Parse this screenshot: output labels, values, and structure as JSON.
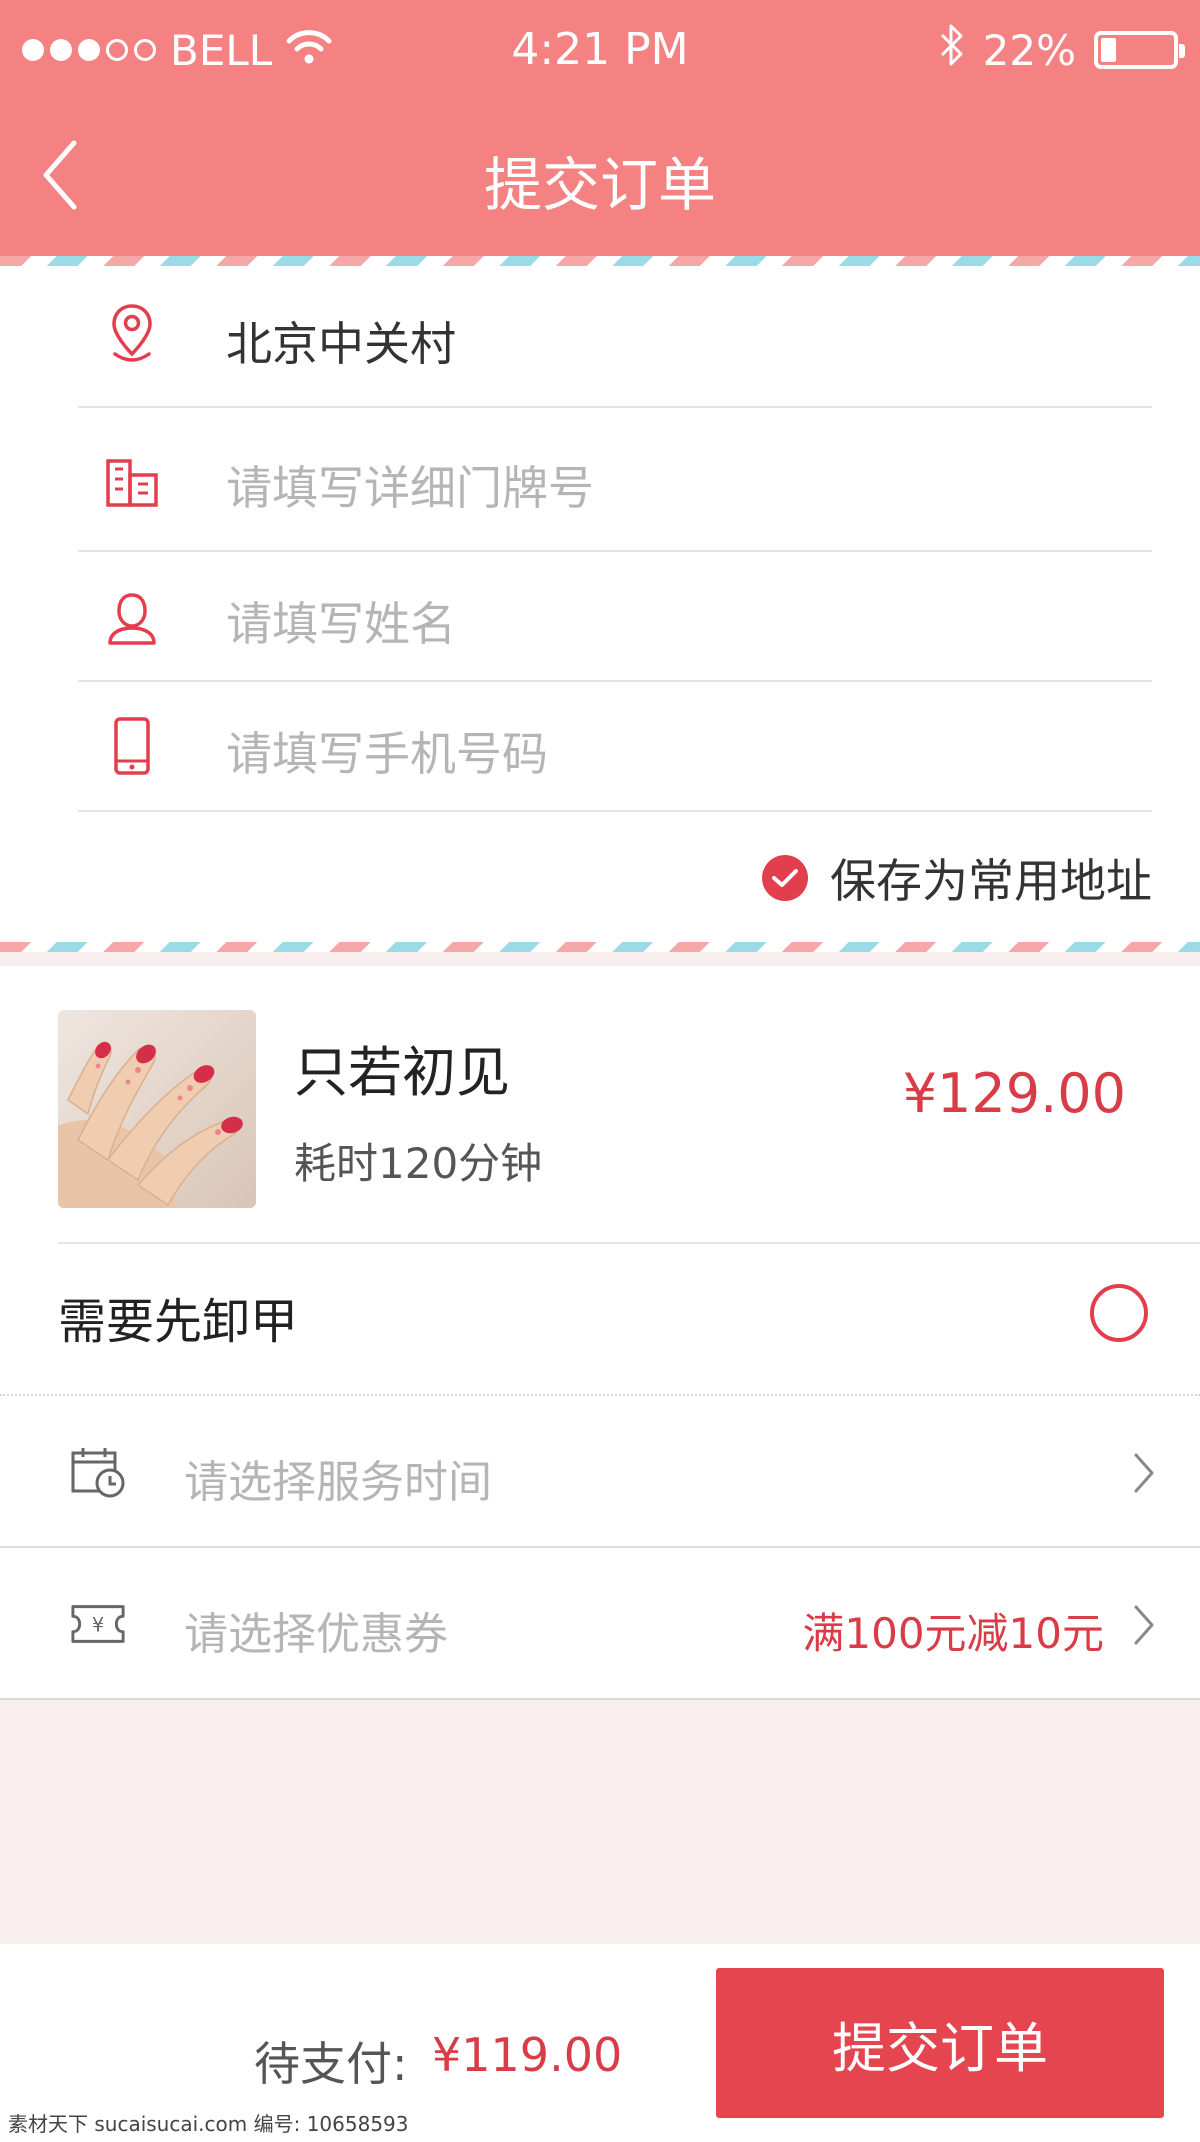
{
  "status_bar": {
    "carrier": "BELL",
    "time": "4:21 PM",
    "battery": "22%",
    "battery_level": 0.22
  },
  "nav": {
    "title": "提交订单"
  },
  "address": {
    "location": "北京中关村",
    "door_placeholder": "请填写详细门牌号",
    "name_placeholder": "请填写姓名",
    "phone_placeholder": "请填写手机号码",
    "save_label": "保存为常用地址"
  },
  "product": {
    "name": "只若初见",
    "duration": "耗时120分钟",
    "price": "¥129.00"
  },
  "options": {
    "remove_label": "需要先卸甲",
    "time_placeholder": "请选择服务时间",
    "coupon_placeholder": "请选择优惠券",
    "coupon_value": "满100元减10元"
  },
  "footer": {
    "pay_label": "待支付:",
    "pay_amount": "¥119.00",
    "submit_label": "提交订单"
  },
  "watermark": "素材天下 sucaisucai.com  编号: 10658593",
  "colors": {
    "header": "#f48282",
    "accent": "#e23e4d",
    "price": "#d93b47",
    "background": "#f8eeee"
  }
}
